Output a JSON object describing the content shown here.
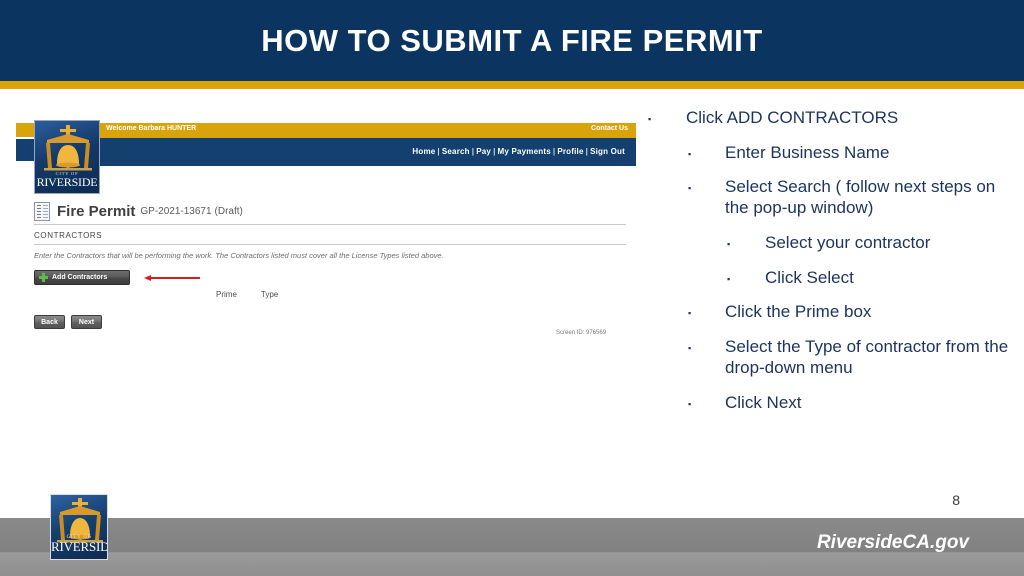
{
  "slide": {
    "title": "HOW TO SUBMIT A FIRE PERMIT",
    "page_number": "8",
    "accent_navy": "#0b3560",
    "accent_gold": "#d9a30c",
    "bullet_text_color": "#1b335e"
  },
  "footer": {
    "site_url": "RiversideCA.gov",
    "logo_city_text": "CITY OF",
    "logo_name_text": "RIVERSIDE"
  },
  "app_screenshot": {
    "logo_city_text": "CITY OF",
    "logo_name_text": "RIVERSIDE",
    "welcome_text": "Welcome Barbara HUNTER",
    "contact_us": "Contact Us",
    "nav_items": [
      "Home",
      "Search",
      "Pay",
      "My Payments",
      "Profile",
      "Sign Out"
    ],
    "nav_separator": "|",
    "permit_title": "Fire Permit",
    "permit_number": "GP-2021-13671",
    "permit_status": "(Draft)",
    "section_label": "CONTRACTORS",
    "section_note": "Enter the Contractors that will be performing the work. The Contractors listed must cover all the License Types listed above.",
    "add_contractors_label": "Add Contractors",
    "column_prime": "Prime",
    "column_type": "Type",
    "back_label": "Back",
    "next_label": "Next",
    "screen_id": "Screen ID: 976569"
  },
  "instructions": [
    {
      "level": 1,
      "marker": "▪",
      "text": "Click ADD CONTRACTORS"
    },
    {
      "level": 2,
      "marker": "▪",
      "text": "Enter Business Name"
    },
    {
      "level": 2,
      "marker": "▪",
      "text": "Select Search ( follow next steps on the pop-up window)"
    },
    {
      "level": 3,
      "marker": "▪",
      "text": "Select your contractor"
    },
    {
      "level": 3,
      "marker": "▪",
      "text": "Click Select"
    },
    {
      "level": 2,
      "marker": "▪",
      "text": " Click the Prime box"
    },
    {
      "level": 2,
      "marker": "▪",
      "text": "Select the Type of contractor from the drop-down menu"
    },
    {
      "level": 2,
      "marker": "▪",
      "text": "Click Next"
    }
  ]
}
